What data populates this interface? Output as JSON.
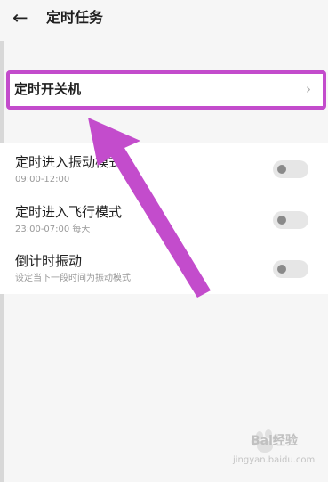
{
  "header": {
    "back_icon": "←",
    "title": "定时任务"
  },
  "scheduled_power": {
    "label": "定时开关机",
    "chevron_icon": "›"
  },
  "items": [
    {
      "title": "定时进入振动模式",
      "subtitle": "09:00-12:00",
      "enabled": false
    },
    {
      "title": "定时进入飞行模式",
      "subtitle": "23:00-07:00 每天",
      "enabled": false
    },
    {
      "title": "倒计时振动",
      "subtitle": "设定当下一段时间为振动模式",
      "enabled": false
    }
  ],
  "annotation": {
    "highlight_color": "#c34ccc",
    "arrow_color": "#c34ccc"
  },
  "watermark": {
    "brand": "Bai经验",
    "url": "jingyan.baidu.com"
  }
}
